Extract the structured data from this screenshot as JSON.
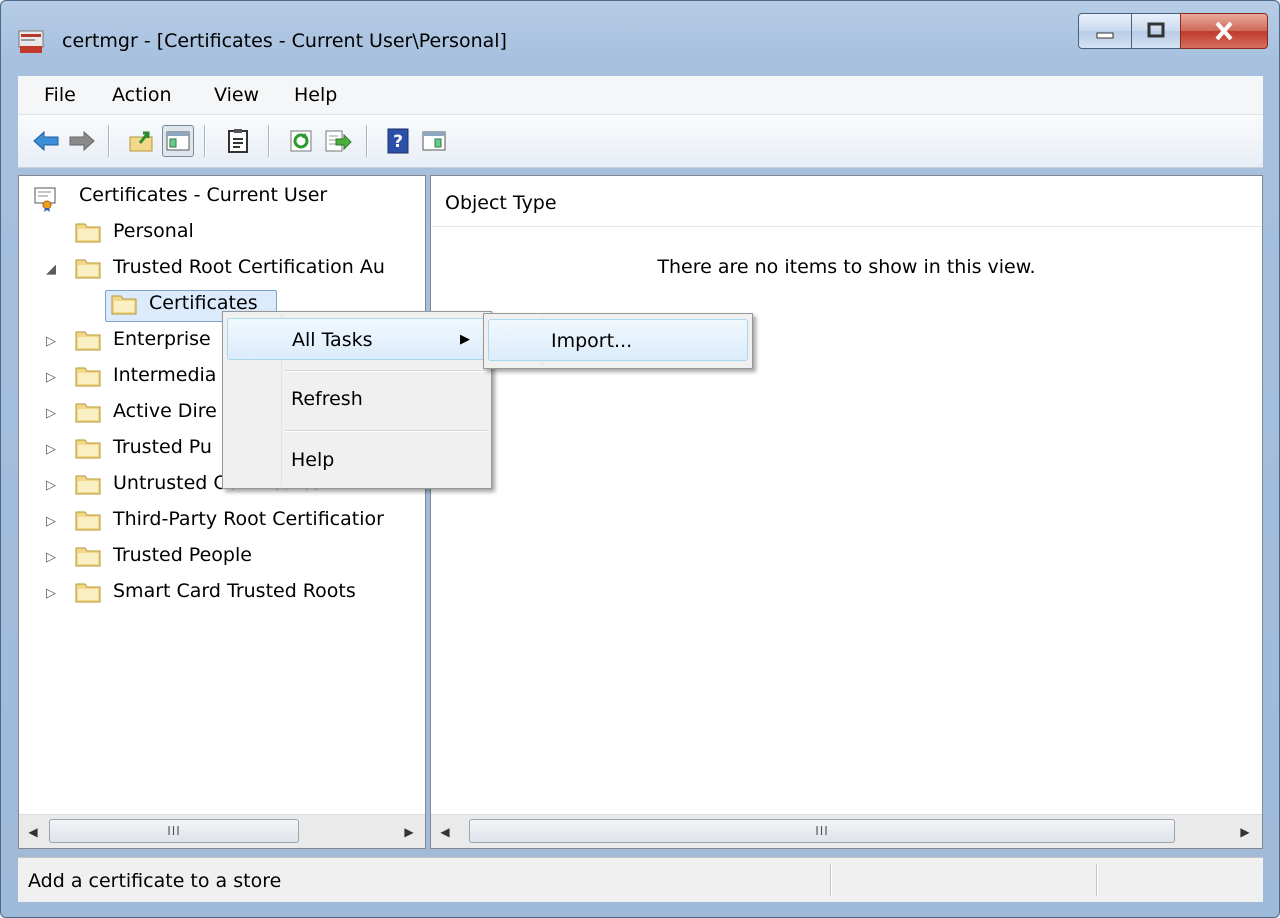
{
  "window": {
    "title": "certmgr - [Certificates - Current User\\Personal]",
    "icon": "certificate-manager-icon",
    "caption_buttons": [
      "minimize-icon",
      "maximize-icon",
      "close-icon"
    ]
  },
  "menubar": {
    "items": [
      "File",
      "Action",
      "View",
      "Help"
    ]
  },
  "toolbar": {
    "buttons": [
      "back-arrow-icon",
      "forward-arrow-icon",
      "up-folder-icon",
      "show-hide-console-tree-icon",
      "properties-icon",
      "refresh-icon",
      "export-list-icon",
      "help-icon",
      "show-hide-action-pane-icon"
    ]
  },
  "tree": {
    "root": "Certificates - Current User",
    "items": [
      {
        "label": "Personal",
        "expander": ""
      },
      {
        "label": "Trusted Root Certification Au",
        "expander": "◢"
      },
      {
        "label": "Certificates",
        "expander": ""
      },
      {
        "label": "Enterprise",
        "expander": "▷"
      },
      {
        "label": "Intermedia",
        "expander": "▷"
      },
      {
        "label": "Active Dire",
        "expander": "▷"
      },
      {
        "label": "Trusted Pu",
        "expander": "▷"
      },
      {
        "label": "Untrusted Certificates",
        "expander": "▷"
      },
      {
        "label": "Third-Party Root Certificatior",
        "expander": "▷"
      },
      {
        "label": "Trusted People",
        "expander": "▷"
      },
      {
        "label": "Smart Card Trusted Roots",
        "expander": "▷"
      }
    ]
  },
  "list": {
    "column_header": "Object Type",
    "empty_message": "There are no items to show in this view."
  },
  "scrollbars": {
    "grip": "III",
    "left_arrow": "◀",
    "right_arrow": "▶"
  },
  "context_menu": {
    "items": [
      "All Tasks",
      "Refresh",
      "Help"
    ],
    "submenu_indicator": "▶"
  },
  "submenu": {
    "items": [
      "Import..."
    ]
  },
  "statusbar": {
    "text": "Add a certificate to a store"
  },
  "colors": {
    "frame": "#a6c0de",
    "close_button": "#c0392b",
    "highlight": "#dcecfc",
    "folder": "#f2d98a"
  }
}
